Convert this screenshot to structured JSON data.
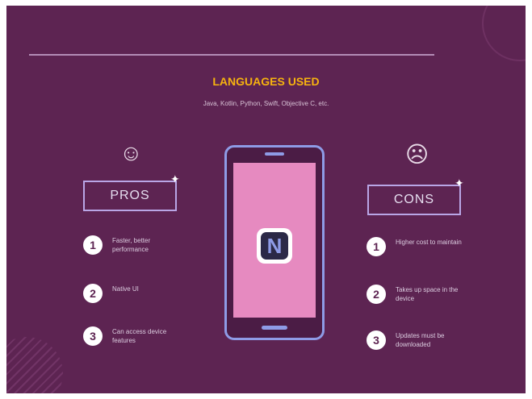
{
  "title": "LANGUAGES USED",
  "subtitle": "Java, Kotlin, Python, Swift, Objective C, etc.",
  "pros": {
    "label": "PROS",
    "face_icon": "smiley-face-icon",
    "items": [
      {
        "num": "1",
        "text": "Faster, better performance"
      },
      {
        "num": "2",
        "text": "Native UI"
      },
      {
        "num": "3",
        "text": "Can access device features"
      }
    ]
  },
  "cons": {
    "label": "CONS",
    "face_icon": "sad-face-icon",
    "items": [
      {
        "num": "1",
        "text": "Higher cost to maintain"
      },
      {
        "num": "2",
        "text": "Takes up space in the device"
      },
      {
        "num": "3",
        "text": "Updates must be downloaded"
      }
    ]
  },
  "phone": {
    "app_letter": "N",
    "app_icon": "app-logo-icon"
  },
  "colors": {
    "background": "#5d2452",
    "title": "#f6b30f",
    "screen": "#e68ac0",
    "accent": "#8e9be6"
  }
}
